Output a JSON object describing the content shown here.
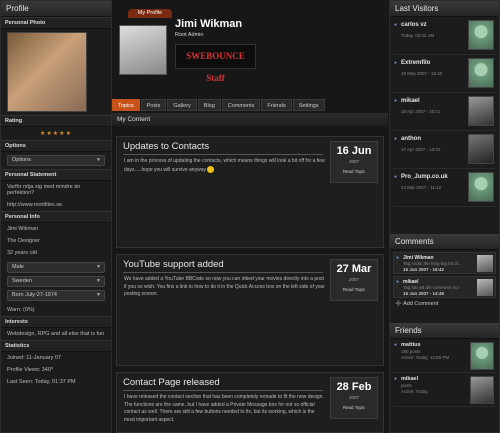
{
  "profile_tab": "My Profile",
  "user": {
    "name": "Jimi Wikman",
    "role": "Root Admin",
    "banner_text": "SWEBOUNCE Staff"
  },
  "left": {
    "title": "Profile",
    "photo_label": "Personal Photo",
    "rating_label": "Rating",
    "rating_stars": "★★★★★",
    "options_label": "Options",
    "options_select": "Options",
    "statement_label": "Personal Statement",
    "statement_text": "Varför nöja sig med mindre än perfektion?",
    "statement_url": "http://www.mortfiles.se",
    "info_label": "Personal Info",
    "info_name": "Jimi Wikman",
    "info_title": "The Designer",
    "info_age": "32 years old",
    "gender": "Male",
    "country": "Sweden",
    "born": "Born July-27-1974",
    "warn": "Warn: (0%)",
    "interests_label": "Interests",
    "interests_text": "Webdesign, RPG and all else that is fun",
    "stats_label": "Statistics",
    "joined": "Joined: 11-January 07",
    "views": "Profile Views: 340*",
    "last_seen": "Last Seen: Today, 01:37 PM"
  },
  "tabs": [
    "Topics",
    "Posts",
    "Gallery",
    "Blog",
    "Comments",
    "Friends",
    "Settings"
  ],
  "my_content_label": "My Content",
  "posts": [
    {
      "title": "Updates to Contacts",
      "body": "I am in the process of updating the contacts, which means things will look a bit off for a few days.....hope you will survive anyway",
      "day": "16 Jun",
      "year": "2007",
      "read": "Read Topic"
    },
    {
      "title": "YouTube support added",
      "body": "We have added a YouTube BBCode so now you can inbed your movies directly into a post if you so wish. You fins a link to how to do it in the Quick Access box on the left side of your posting screen.",
      "day": "27 Mar",
      "year": "2007",
      "read": "Read Topic"
    },
    {
      "title": "Contact Page released",
      "body": "I have released the contact section that has been completely remade to fit the new design. The functions are the same, but I have added a Private Message box for not so official contact as well. There are still a few buttons needed to fix, but its working, which is the most important aspect.",
      "day": "28 Feb",
      "year": "2007",
      "read": "Read Topic"
    }
  ],
  "right": {
    "visitors_title": "Last Visitors",
    "visitors": [
      {
        "name": "carlos vz",
        "time": "Today, 03:42 AM"
      },
      {
        "name": "Extremfilo",
        "time": "19 May 2007 - 15:32"
      },
      {
        "name": "mikael",
        "time": "18 Apr 2007 - 20:11"
      },
      {
        "name": "anthon",
        "time": "17 Apr 2007 - 13:01"
      },
      {
        "name": "Pro_Jump.co.uk",
        "time": "24 Mar 2007 - 11:42"
      }
    ],
    "comments_title": "Comments",
    "comments": [
      {
        "name": "Jimi Wikman",
        "text": "Tag rocks the blog tag bit of...",
        "time": "15 Jun 2007 - 16:42"
      },
      {
        "name": "mikael",
        "text": "Tag här ett din comment nu!",
        "time": "15 Jun 2007 - 14:46"
      }
    ],
    "add_comment": "Add Comment",
    "friends_title": "Friends",
    "friends": [
      {
        "name": "mattius",
        "sub": "190 posts",
        "activity": "Active: Today, 12:50 PM"
      },
      {
        "name": "mikael",
        "sub": "posts",
        "activity": "Active: Today,"
      }
    ]
  }
}
